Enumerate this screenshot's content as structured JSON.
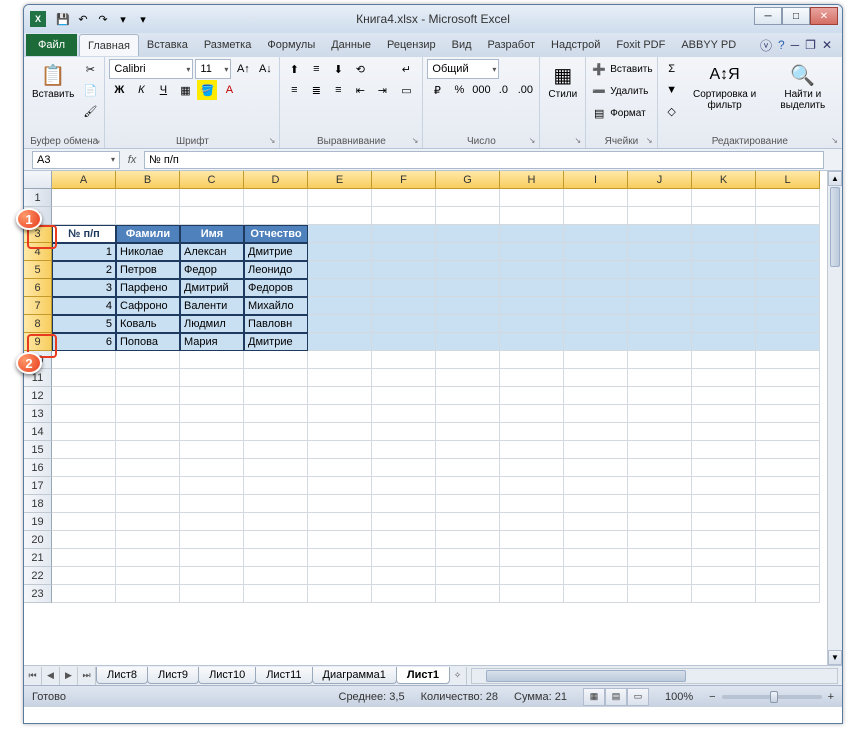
{
  "window": {
    "title": "Книга4.xlsx - Microsoft Excel"
  },
  "qat": {
    "save": "💾",
    "undo": "↶",
    "redo": "↷",
    "more1": "▾",
    "more2": "▾"
  },
  "tabs": {
    "file": "Файл",
    "items": [
      "Главная",
      "Вставка",
      "Разметка",
      "Формулы",
      "Данные",
      "Рецензир",
      "Вид",
      "Разработ",
      "Надстрой",
      "Foxit PDF",
      "ABBYY PD"
    ],
    "active": 0
  },
  "ribbon": {
    "clipboard": {
      "paste": "Вставить",
      "label": "Буфер обмена"
    },
    "font": {
      "name": "Calibri",
      "size": "11",
      "label": "Шрифт"
    },
    "align": {
      "label": "Выравнивание"
    },
    "number": {
      "format": "Общий",
      "label": "Число"
    },
    "styles": {
      "btn": "Стили"
    },
    "cells": {
      "insert": "Вставить",
      "delete": "Удалить",
      "format": "Формат",
      "label": "Ячейки"
    },
    "editing": {
      "sort": "Сортировка и фильтр",
      "find": "Найти и выделить",
      "label": "Редактирование"
    }
  },
  "formula_bar": {
    "name_box": "A3",
    "fx": "fx",
    "formula": "№ п/п"
  },
  "columns": [
    "A",
    "B",
    "C",
    "D",
    "E",
    "F",
    "G",
    "H",
    "I",
    "J",
    "K",
    "L"
  ],
  "rows": [
    1,
    2,
    3,
    4,
    5,
    6,
    7,
    8,
    9,
    10,
    11,
    12,
    13,
    14,
    15,
    16,
    17,
    18,
    19,
    20,
    21,
    22,
    23
  ],
  "selected_rows": [
    3,
    4,
    5,
    6,
    7,
    8,
    9
  ],
  "table": {
    "header": [
      "№ п/п",
      "Фамили",
      "Имя",
      "Отчество"
    ],
    "rows": [
      [
        1,
        "Николае",
        "Алексан",
        "Дмитрие"
      ],
      [
        2,
        "Петров",
        "Федор",
        "Леонидо"
      ],
      [
        3,
        "Парфено",
        "Дмитрий",
        "Федоров"
      ],
      [
        4,
        "Сафроно",
        "Валенти",
        "Михайло"
      ],
      [
        5,
        "Коваль",
        "Людмил",
        "Павловн"
      ],
      [
        6,
        "Попова",
        "Мария",
        "Дмитрие"
      ]
    ]
  },
  "callouts": {
    "c1": "1",
    "c2": "2"
  },
  "sheets": {
    "nav": [
      "⏮",
      "◀",
      "▶",
      "⏭"
    ],
    "items": [
      "Лист8",
      "Лист9",
      "Лист10",
      "Лист11",
      "Диаграмма1",
      "Лист1"
    ],
    "active": 5,
    "add": "✧"
  },
  "status": {
    "ready": "Готово",
    "avg_label": "Среднее:",
    "avg": "3,5",
    "count_label": "Количество:",
    "count": "28",
    "sum_label": "Сумма:",
    "sum": "21",
    "zoom": "100%",
    "minus": "−",
    "plus": "+"
  }
}
